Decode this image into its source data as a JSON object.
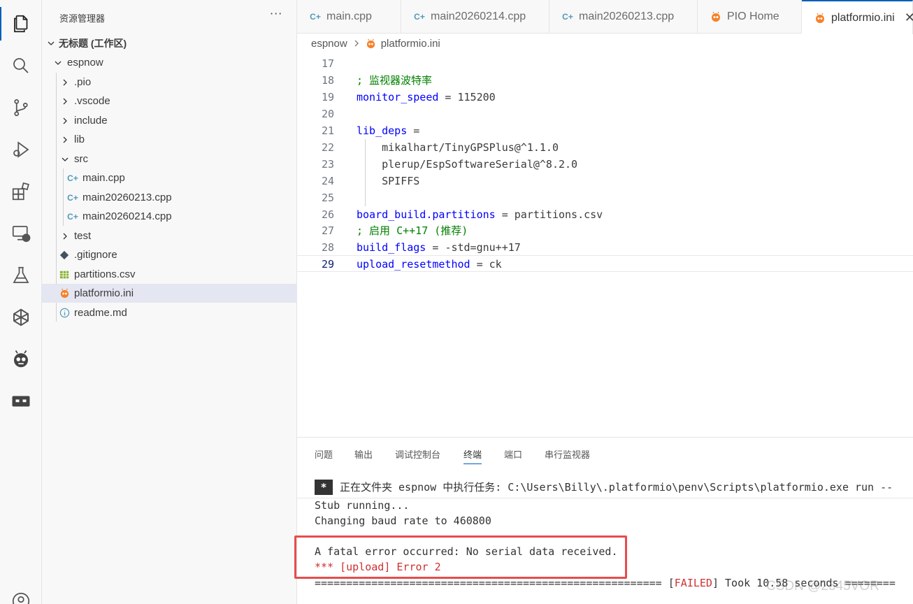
{
  "sidebar": {
    "title": "资源管理器",
    "more": "···",
    "workspace": "无标题 (工作区)",
    "project": "espnow",
    "folders": [
      ".pio",
      ".vscode",
      "include",
      "lib"
    ],
    "src_folder": "src",
    "src_files": [
      "main.cpp",
      "main20260213.cpp",
      "main20260214.cpp"
    ],
    "test_folder": "test",
    "root_files": [
      ".gitignore",
      "partitions.csv",
      "platformio.ini",
      "readme.md"
    ]
  },
  "tabs": [
    {
      "label": "main.cpp",
      "icon": "cpp-icon"
    },
    {
      "label": "main20260214.cpp",
      "icon": "cpp-icon"
    },
    {
      "label": "main20260213.cpp",
      "icon": "cpp-icon"
    },
    {
      "label": "PIO Home",
      "icon": "platformio-icon"
    },
    {
      "label": "platformio.ini",
      "icon": "platformio-icon",
      "close": "✕"
    }
  ],
  "breadcrumb": {
    "folder": "espnow",
    "file": "platformio.ini"
  },
  "editor": {
    "lines": [
      {
        "n": "17"
      },
      {
        "n": "18",
        "comment": "; 监视器波特率"
      },
      {
        "n": "19",
        "key": "monitor_speed",
        "op": " = ",
        "val": "115200"
      },
      {
        "n": "20"
      },
      {
        "n": "21",
        "key": "lib_deps",
        "op": " ="
      },
      {
        "n": "22",
        "val": "    mikalhart/TinyGPSPlus@^1.1.0"
      },
      {
        "n": "23",
        "val": "    plerup/EspSoftwareSerial@^8.2.0"
      },
      {
        "n": "24",
        "val": "    SPIFFS"
      },
      {
        "n": "25"
      },
      {
        "n": "26",
        "key": "board_build.partitions",
        "op": " = ",
        "val": "partitions.csv"
      },
      {
        "n": "27",
        "comment": "; 启用 C++17 (推荐)"
      },
      {
        "n": "28",
        "key": "build_flags",
        "op": " = ",
        "val": "-std=gnu++17"
      },
      {
        "n": "29",
        "key": "upload_resetmethod",
        "op": " = ",
        "val": "ck"
      }
    ]
  },
  "panel": {
    "tabs": [
      "问题",
      "输出",
      "调试控制台",
      "终端",
      "端口",
      "串行监视器"
    ],
    "active_tab": "终端",
    "task_star": "*",
    "task_line": "正在文件夹 espnow 中执行任务: C:\\Users\\Billy\\.platformio\\penv\\Scripts\\platformio.exe run --",
    "out1": "Stub running...",
    "out2": "Changing baud rate to 460800",
    "fatal": "A fatal error occurred: No serial data received.",
    "error": "*** [upload] Error 2",
    "summary_rule": "=======================================================",
    "failed_open": " [",
    "failed": "FAILED",
    "failed_tail": "] Took 10.58 seconds ========"
  },
  "watermark": "CSDN @2345VOR",
  "colors": {
    "accent": "#005fb8",
    "error": "#cd3131",
    "highlight_box": "#e84c4c",
    "comment": "#008000",
    "keyword": "#0000ff"
  }
}
